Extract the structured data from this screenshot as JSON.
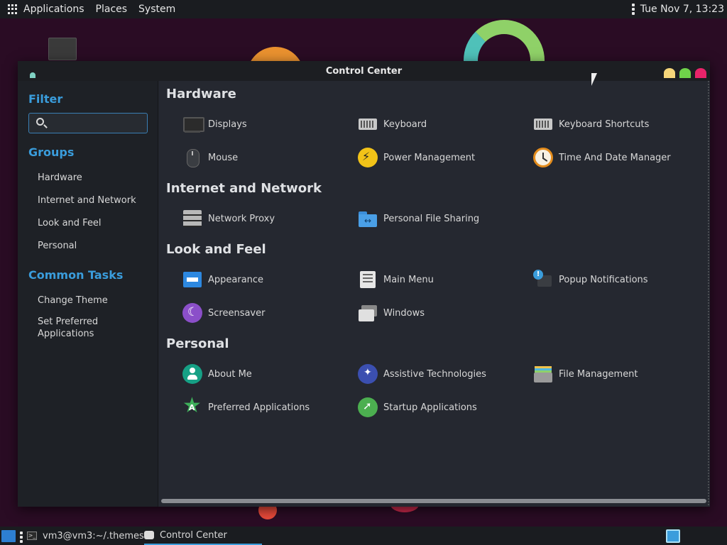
{
  "top_panel": {
    "menus": [
      "Applications",
      "Places",
      "System"
    ],
    "clock": "Tue Nov 7, 13:23"
  },
  "window": {
    "title": "Control Center"
  },
  "sidebar": {
    "filter_heading": "Filter",
    "search_placeholder": "",
    "groups_heading": "Groups",
    "groups": [
      "Hardware",
      "Internet and Network",
      "Look and Feel",
      "Personal"
    ],
    "common_tasks_heading": "Common Tasks",
    "tasks": [
      "Change Theme",
      "Set Preferred\nApplications"
    ]
  },
  "categories": [
    {
      "title": "Hardware",
      "items": [
        {
          "label": "Displays",
          "icon": "display-icon"
        },
        {
          "label": "Keyboard",
          "icon": "keyboard-icon"
        },
        {
          "label": "Keyboard Shortcuts",
          "icon": "keyboard-icon"
        },
        {
          "label": "Mouse",
          "icon": "mouse-icon"
        },
        {
          "label": "Power Management",
          "icon": "power-icon"
        },
        {
          "label": "Time And Date Manager",
          "icon": "clock-icon"
        }
      ]
    },
    {
      "title": "Internet and Network",
      "items": [
        {
          "label": "Network Proxy",
          "icon": "server-icon"
        },
        {
          "label": "Personal File Sharing",
          "icon": "shared-folder-icon"
        }
      ]
    },
    {
      "title": "Look and Feel",
      "items": [
        {
          "label": "Appearance",
          "icon": "appearance-icon"
        },
        {
          "label": "Main Menu",
          "icon": "menu-list-icon"
        },
        {
          "label": "Popup Notifications",
          "icon": "notification-icon"
        },
        {
          "label": "Screensaver",
          "icon": "moon-icon"
        },
        {
          "label": "Windows",
          "icon": "windows-icon"
        }
      ]
    },
    {
      "title": "Personal",
      "items": [
        {
          "label": "About Me",
          "icon": "user-icon"
        },
        {
          "label": "Assistive Technologies",
          "icon": "accessibility-icon"
        },
        {
          "label": "File Management",
          "icon": "file-cabinet-icon"
        },
        {
          "label": "Preferred Applications",
          "icon": "star-icon"
        },
        {
          "label": "Startup Applications",
          "icon": "rocket-icon"
        }
      ]
    }
  ],
  "taskbar": {
    "tasks": [
      {
        "label": "vm3@vm3:~/.themes",
        "icon": "terminal-icon"
      },
      {
        "label": "Control Center",
        "icon": "control-center-icon"
      }
    ]
  },
  "colors": {
    "accent": "#3a9ddc",
    "window_bg": "#252830",
    "sidebar_bg": "#1e2126",
    "panel_bg": "#1a1c20",
    "desktop_bg": "#2a0c24"
  }
}
